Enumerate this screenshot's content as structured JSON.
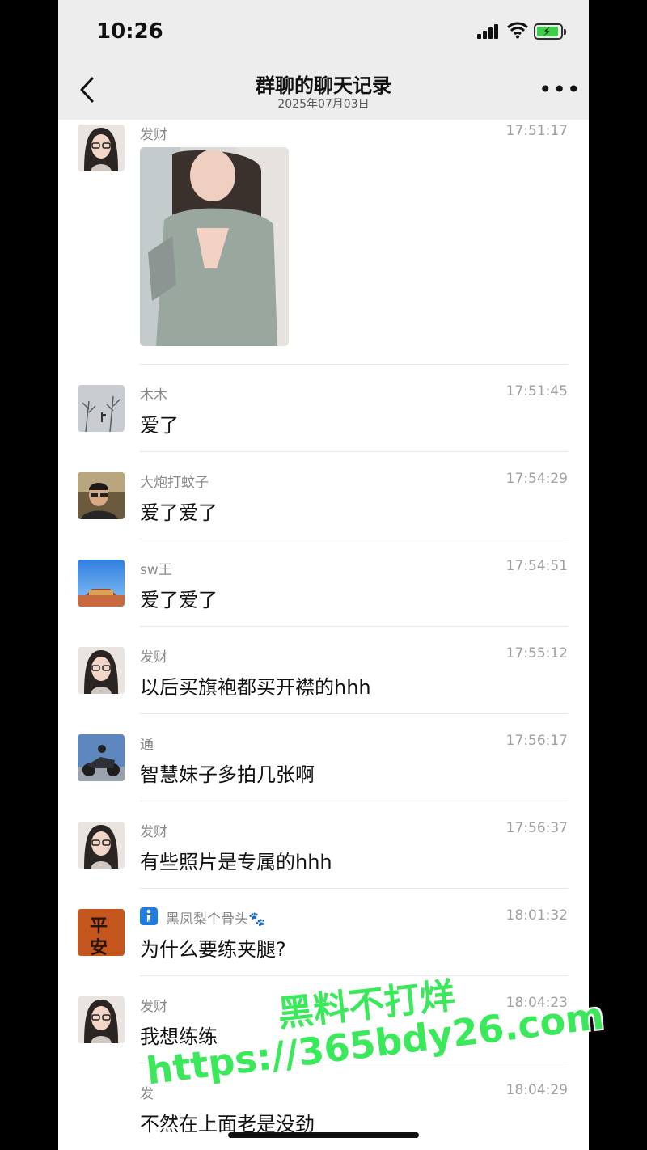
{
  "status": {
    "time": "10:26"
  },
  "header": {
    "title": "群聊的聊天记录",
    "date": "2025年07月03日"
  },
  "messages": [
    {
      "name": "发财",
      "time": "17:51:17",
      "text": "",
      "avatar": "girl-glasses",
      "has_photo": true
    },
    {
      "name": "木木",
      "time": "17:51:45",
      "text": "爱了",
      "avatar": "snowy-trees"
    },
    {
      "name": "大炮打蚊子",
      "time": "17:54:29",
      "text": "爱了爱了",
      "avatar": "man-car"
    },
    {
      "name": "sw王",
      "time": "17:54:51",
      "text": "爱了爱了",
      "avatar": "palace-sky"
    },
    {
      "name": "发财",
      "time": "17:55:12",
      "text": "以后买旗袍都买开襟的hhh",
      "avatar": "girl-glasses"
    },
    {
      "name": "通",
      "time": "17:56:17",
      "text": "智慧妹子多拍几张啊",
      "avatar": "motorcycle"
    },
    {
      "name": "发财",
      "time": "17:56:37",
      "text": "有些照片是专属的hhh",
      "avatar": "girl-glasses"
    },
    {
      "name": "黑凤梨个骨头🐾",
      "time": "18:01:32",
      "text": "为什么要练夹腿?",
      "avatar": "ping-an",
      "badge": "person-icon"
    },
    {
      "name": "发财",
      "time": "18:04:23",
      "text": "我想练练",
      "avatar": "girl-glasses"
    },
    {
      "name": "发",
      "time": "18:04:29",
      "text": "不然在上面老是没劲",
      "avatar": ""
    }
  ],
  "watermark": {
    "line1": "黑料不打烊",
    "line2": "https://365bdy26.com"
  },
  "avatar_text": {
    "ping_an_top": "平",
    "ping_an_bottom": "安"
  },
  "colors": {
    "bar_bg": "#ededed",
    "watermark_green": "#39e95a",
    "battery_green": "#3ecf4a"
  }
}
